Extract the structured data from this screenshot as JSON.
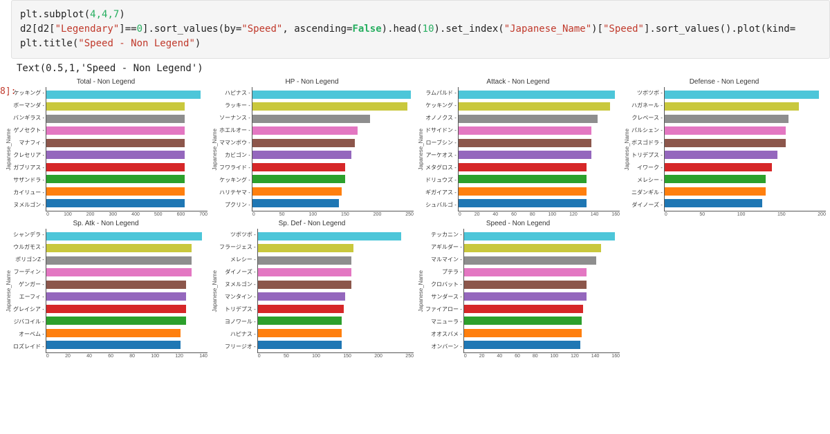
{
  "code": {
    "line1_pre": "plt.subplot(",
    "line1_args": "4,4,7",
    "line1_post": ")",
    "line2a": "d2[d2[",
    "line2_str1": "\"Legendary\"",
    "line2b": "]==",
    "line2_num0": "0",
    "line2c": "].sort_values(by=",
    "line2_str2": "\"Speed\"",
    "line2d": ", ascending=",
    "line2_bool": "False",
    "line2e": ").head(",
    "line2_num10": "10",
    "line2f": ").set_index(",
    "line2_str3": "\"Japanese_Name\"",
    "line2g": ")[",
    "line2_str4": "\"Speed\"",
    "line2h": "].sort_values().plot(kind=",
    "line3a": "plt.title(",
    "line3_str": "\"Speed - Non Legend\"",
    "line3b": ")"
  },
  "output_marker": "8]:",
  "output_text": "Text(0.5,1,'Speed - Non Legend')",
  "palette": [
    "#4dc6d9",
    "#c9c83d",
    "#8e8e8e",
    "#e377c2",
    "#8c564b",
    "#9467bd",
    "#d62728",
    "#2ca02c",
    "#ff7f0e",
    "#1f77b4"
  ],
  "ylabel": "Japanese_Name",
  "chart_data": [
    {
      "type": "bar",
      "title": "Total - Non Legend",
      "xmax": 700,
      "categories": [
        "ケッキング",
        "ボーマンダ",
        "バンギラス",
        "ゲノセクト",
        "マナフィ",
        "クレセリア",
        "ガブリアス",
        "サザンドラ",
        "カイリュー",
        "ヌメルゴン"
      ],
      "values": [
        670,
        600,
        600,
        600,
        600,
        600,
        600,
        600,
        600,
        600
      ]
    },
    {
      "type": "bar",
      "title": "HP - Non Legend",
      "xmax": 260,
      "categories": [
        "ハピナス",
        "ラッキー",
        "ソーナンス",
        "ホエルオー",
        "ママンボウ",
        "カビゴン",
        "フワライド",
        "ケッキング",
        "ハリテヤマ",
        "プクリン"
      ],
      "values": [
        255,
        250,
        190,
        170,
        165,
        160,
        150,
        150,
        144,
        140
      ]
    },
    {
      "type": "bar",
      "title": "Attack - Non Legend",
      "xmax": 170,
      "categories": [
        "ラムパルド",
        "ケッキング",
        "オノノクス",
        "ドサイドン",
        "ローブシン",
        "アーケオス",
        "メタグロス",
        "ドリュウズ",
        "ギガイアス",
        "シュバルゴ"
      ],
      "values": [
        165,
        160,
        147,
        140,
        140,
        140,
        135,
        135,
        135,
        135
      ]
    },
    {
      "type": "bar",
      "title": "Defense - Non Legend",
      "xmax": 240,
      "categories": [
        "ツボツボ",
        "ハガネール",
        "クレベース",
        "パルシェン",
        "ボスゴドラ",
        "トリデプス",
        "イワーク",
        "メレシー",
        "ニダンギル",
        "ダイノーズ"
      ],
      "values": [
        230,
        200,
        184,
        180,
        180,
        168,
        160,
        150,
        150,
        145
      ]
    },
    {
      "type": "bar",
      "title": "Sp. Atk - Non Legend",
      "xmax": 150,
      "categories": [
        "シャンデラ",
        "ウルガモス",
        "ポリゴンZ",
        "フーディン",
        "ゲンガー",
        "エーフィ",
        "グレイシア",
        "ジバコイル",
        "オーベム",
        "ロズレイド"
      ],
      "values": [
        145,
        135,
        135,
        135,
        130,
        130,
        130,
        130,
        125,
        125
      ]
    },
    {
      "type": "bar",
      "title": "Sp. Def - Non Legend",
      "xmax": 250,
      "categories": [
        "ツボツボ",
        "フラージェス",
        "メレシー",
        "ダイノーズ",
        "ヌメルゴン",
        "マンタイン",
        "トリデプス",
        "ヨノワール",
        "ハピナス",
        "フリージオ"
      ],
      "values": [
        230,
        154,
        150,
        150,
        150,
        140,
        138,
        135,
        135,
        135
      ]
    },
    {
      "type": "bar",
      "title": "Speed - Non Legend",
      "xmax": 165,
      "categories": [
        "テッカニン",
        "アギルダー",
        "マルマイン",
        "プテラ",
        "クロバット",
        "サンダース",
        "ファイアロー",
        "マニューラ",
        "オオスバメ",
        "オンバーン"
      ],
      "values": [
        160,
        145,
        140,
        130,
        130,
        130,
        126,
        125,
        125,
        123
      ]
    }
  ]
}
